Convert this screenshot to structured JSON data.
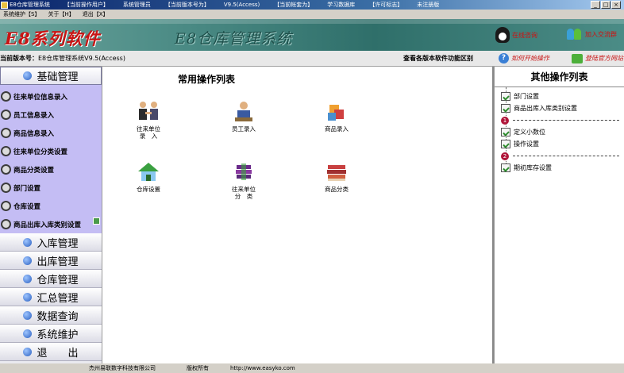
{
  "window": {
    "title": "E8仓库管理系统",
    "segments": [
      "【当前操作用户】",
      "系统管理员",
      "【当前版本号为】",
      "V9.5(Access)",
      "【当前帐套为】",
      "学习数据库",
      "【许可标志】",
      "未注册版"
    ],
    "controls": [
      "_",
      "□",
      "×"
    ]
  },
  "menubar": {
    "items": [
      "系统维护【S】",
      "关于【H】",
      "退出【X】"
    ]
  },
  "banner": {
    "brand": "E8系列软件",
    "product": "E8仓库管理系统",
    "qq_online": "在线咨询",
    "qq_group": "加入交流群"
  },
  "infobar": {
    "version_label": "当前版本号：",
    "version_value": "E8仓库管理系统V9.5(Access)",
    "compare": "查看各版本软件功能区别",
    "how_to_start": "如何开始操作",
    "official_site": "登陆官方网站"
  },
  "left_nav": {
    "basic": "基础管理",
    "basic_items": [
      "往来单位信息录入",
      "员工信息录入",
      "商品信息录入",
      "往来单位分类设置",
      "商品分类设置",
      "部门设置",
      "仓库设置",
      "商品出库入库类别设置"
    ],
    "sections": [
      "入库管理",
      "出库管理",
      "仓库管理",
      "汇总管理",
      "数据查询",
      "系统维护",
      "退　　出"
    ]
  },
  "center": {
    "title": "常用操作列表",
    "tiles": [
      {
        "label": "往来单位\n录　入",
        "icon": "handshake-icon"
      },
      {
        "label": "员工录入",
        "icon": "employee-icon"
      },
      {
        "label": "商品录入",
        "icon": "product-icon"
      },
      {
        "label": "仓库设置",
        "icon": "warehouse-icon"
      },
      {
        "label": "往来单位\n分　类",
        "icon": "book-stack-icon"
      },
      {
        "label": "商品分类",
        "icon": "books-icon"
      }
    ]
  },
  "right": {
    "title": "其他操作列表",
    "items": [
      "部门设置",
      "商品出库入库类别设置",
      "定义小数位",
      "操作设置",
      "期初库存设置"
    ],
    "separators": [
      "1",
      "2"
    ]
  },
  "footer": {
    "company": "杰州易联数字科技有限公司",
    "rights": "版权所有",
    "url": "http://www.easyko.com"
  },
  "colors": {
    "banner_teal": "#3f7f79",
    "nav_purple": "#c4bdf4",
    "brand_red": "#c81414"
  }
}
